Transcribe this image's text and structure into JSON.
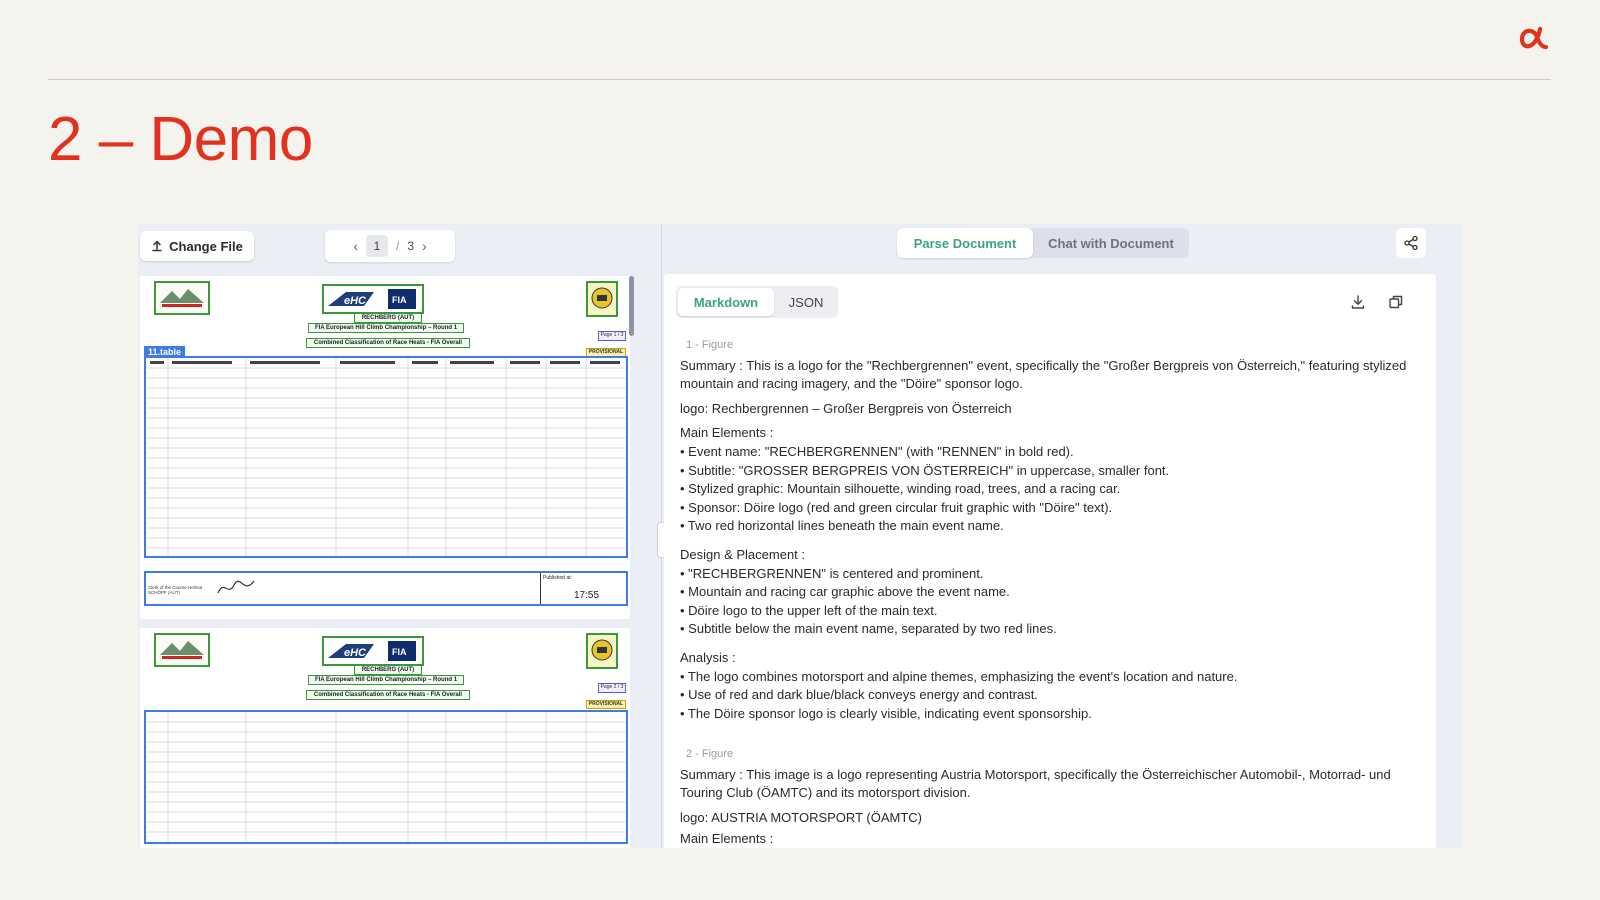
{
  "slide": {
    "title": "2 – Demo"
  },
  "left_panel": {
    "change_file_label": "Change File",
    "pager": {
      "current": "1",
      "separator": "/",
      "total": "3"
    }
  },
  "document_preview": {
    "page1": {
      "event_line": "RECHBERG (AUT)",
      "championship": "FIA European Hill Climb Championship – Round 1",
      "classification": "Combined Classification of Race Heats - FIA Overall",
      "page_label": "Page 1 / 3",
      "provisional": "PROVISIONAL",
      "table_tag": "11.table",
      "clerk": "Clerk of the Course Helmut SCHÖPF (AUT)",
      "published": "Published at:",
      "time": "17:55"
    },
    "page2": {
      "event_line": "RECHBERG (AUT)",
      "championship": "FIA European Hill Climb Championship – Round 1",
      "classification": "Combined Classification of Race Heats - FIA Overall",
      "page_label": "Page 2 / 3",
      "provisional": "PROVISIONAL"
    }
  },
  "right_panel": {
    "tabs": [
      {
        "label": "Parse Document",
        "active": true
      },
      {
        "label": "Chat with Document",
        "active": false
      }
    ],
    "format_tabs": [
      {
        "label": "Markdown",
        "active": true
      },
      {
        "label": "JSON",
        "active": false
      }
    ],
    "icons": [
      "share-icon",
      "download-icon",
      "copy-icon"
    ]
  },
  "parsed": {
    "figure1": {
      "label": "1 - Figure",
      "summary": "Summary : This is a logo for the \"Rechbergrennen\" event, specifically the \"Großer Bergpreis von Österreich,\" featuring stylized mountain and racing imagery, and the \"Döire\" sponsor logo.",
      "logo": "logo: Rechbergrennen – Großer Bergpreis von Österreich",
      "main_heading": "Main Elements :",
      "main_items": [
        "• Event name: \"RECHBERGRENNEN\" (with \"RENNEN\" in bold red).",
        "• Subtitle: \"GROSSER BERGPREIS VON ÖSTERREICH\" in uppercase, smaller font.",
        "• Stylized graphic: Mountain silhouette, winding road, trees, and a racing car.",
        "• Sponsor: Döire logo (red and green circular fruit graphic with \"Döire\" text).",
        "• Two red horizontal lines beneath the main event name."
      ],
      "design_heading": "Design & Placement :",
      "design_items": [
        "• \"RECHBERGRENNEN\" is centered and prominent.",
        "• Mountain and racing car graphic above the event name.",
        "• Döire logo to the upper left of the main text.",
        "• Subtitle below the main event name, separated by two red lines."
      ],
      "analysis_heading": "Analysis :",
      "analysis_items": [
        "• The logo combines motorsport and alpine themes, emphasizing the event's location and nature.",
        "• Use of red and dark blue/black conveys energy and contrast.",
        "• The Döire sponsor logo is clearly visible, indicating event sponsorship."
      ]
    },
    "figure2": {
      "label": "2 - Figure",
      "summary": "Summary : This image is a logo representing Austria Motorsport, specifically the Österreichischer Automobil-, Motorrad- und Touring Club (ÖAMTC) and its motorsport division.",
      "logo": "logo: AUSTRIA MOTORSPORT (ÖAMTC)",
      "main_heading": "Main Elements :"
    }
  },
  "colors": {
    "brand_red": "#e0321e",
    "accent_green": "#3aa67a",
    "table_highlight": "#3d7be6"
  }
}
